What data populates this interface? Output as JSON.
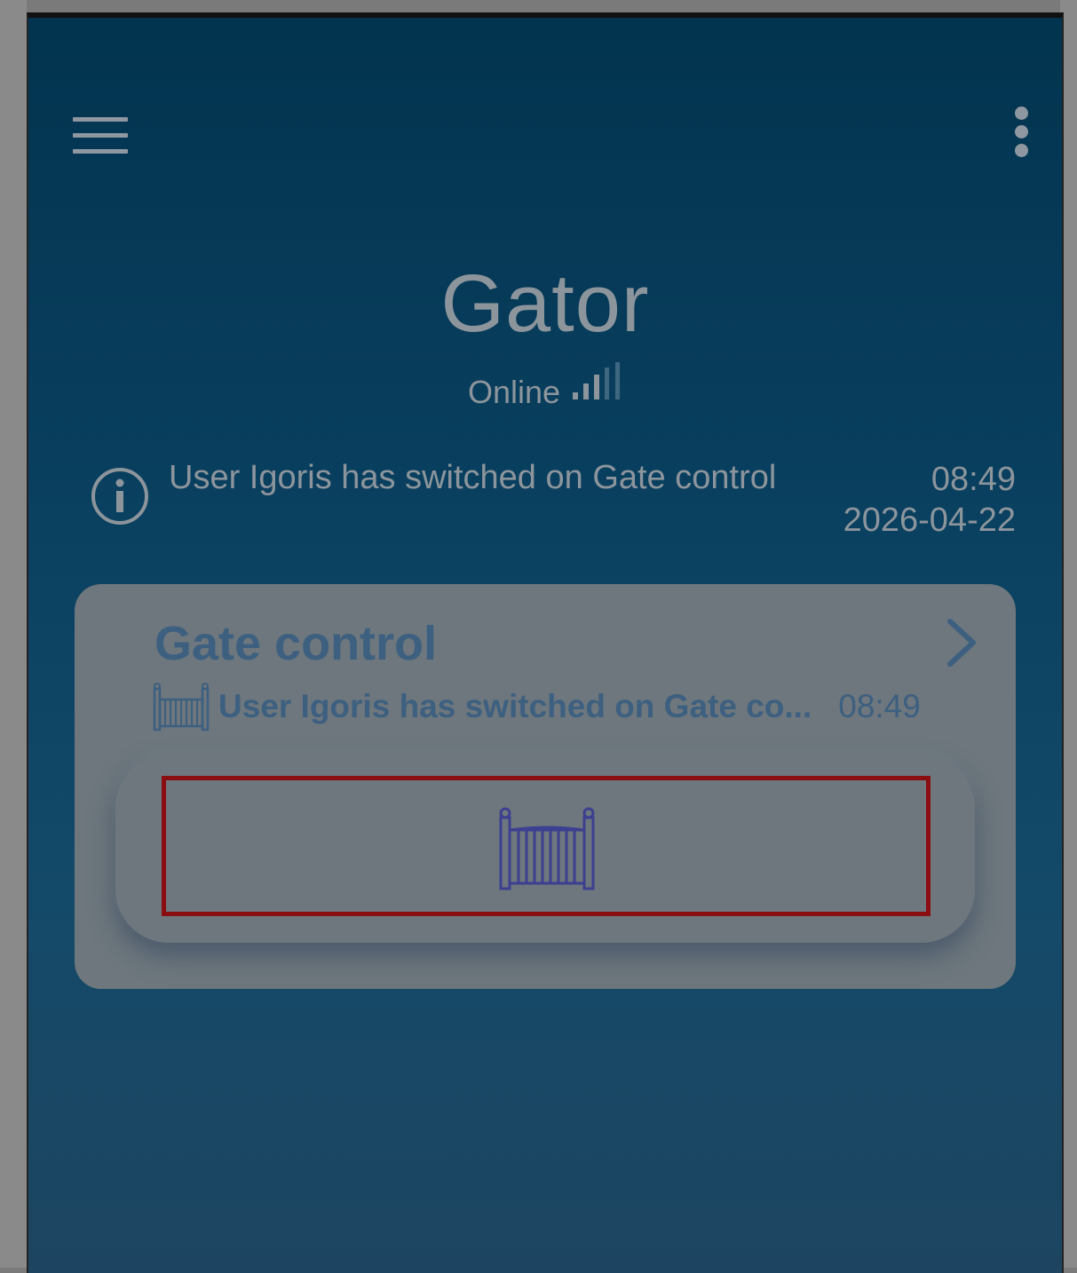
{
  "header": {
    "menu_icon": "hamburger-menu-icon",
    "overflow_icon": "kebab-menu-icon"
  },
  "device": {
    "name": "Gator",
    "status": "Online"
  },
  "last_event": {
    "message": "User Igoris has switched on Gate control",
    "time": "08:49",
    "date": "2026-04-22"
  },
  "card": {
    "title": "Gate control",
    "event_text": "User Igoris has switched on Gate co...",
    "event_time": "08:49",
    "button_icon": "gate-icon"
  },
  "colors": {
    "highlight_border": "#8a0d12",
    "title_text": "#3d5f80",
    "gate_icon": "#3d3f90"
  }
}
